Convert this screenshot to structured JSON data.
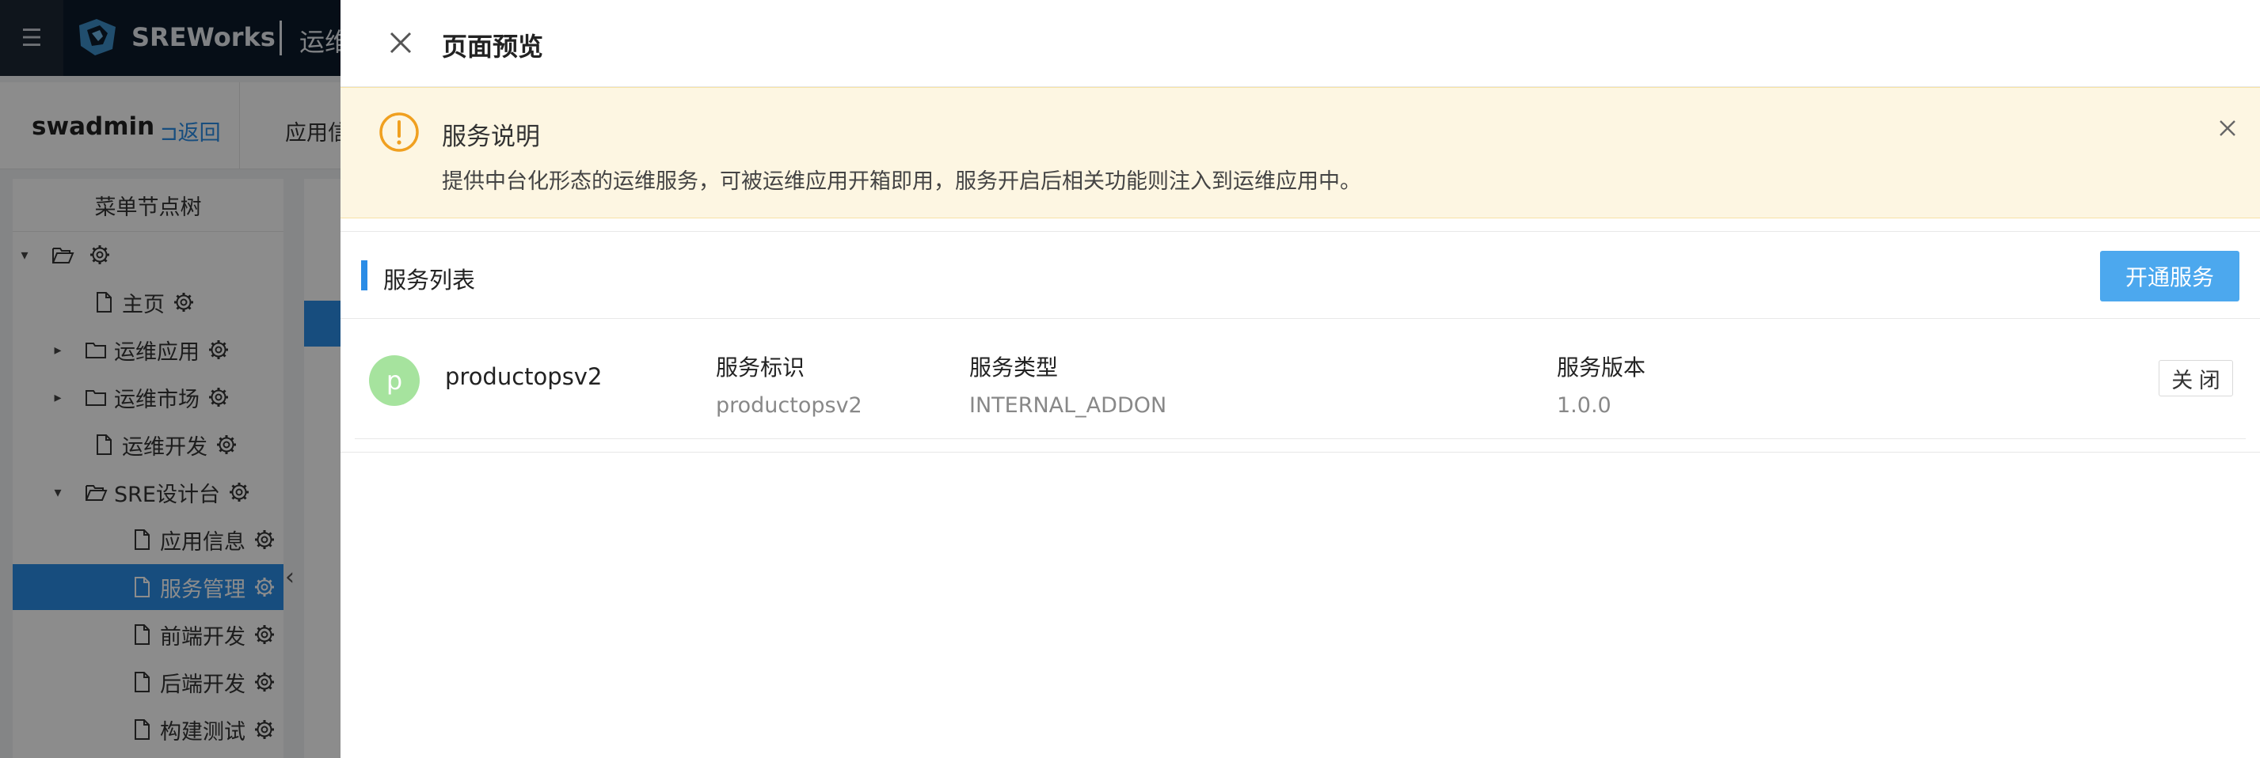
{
  "topbar": {
    "menu_icon": "hamburger-icon",
    "brand": "SREWorks",
    "subtitle": "运维"
  },
  "subbar": {
    "user": "swadmin",
    "back_label": "返回",
    "tab_label": "应用信"
  },
  "tree": {
    "title": "菜单节点树",
    "items": [
      {
        "label": "",
        "type": "folder-open",
        "expanded": true
      },
      {
        "label": "主页",
        "type": "file"
      },
      {
        "label": "运维应用",
        "type": "folder",
        "expanded": false
      },
      {
        "label": "运维市场",
        "type": "folder",
        "expanded": false
      },
      {
        "label": "运维开发",
        "type": "file"
      },
      {
        "label": "SRE设计台",
        "type": "folder-open",
        "expanded": true
      },
      {
        "label": "应用信息",
        "type": "file"
      },
      {
        "label": "服务管理",
        "type": "file",
        "selected": true
      },
      {
        "label": "前端开发",
        "type": "file"
      },
      {
        "label": "后端开发",
        "type": "file"
      },
      {
        "label": "构建测试",
        "type": "file"
      }
    ]
  },
  "drawer": {
    "title": "页面预览",
    "alert": {
      "title": "服务说明",
      "description": "提供中台化形态的运维服务，可被运维应用开箱即用，服务开启后相关功能则注入到运维应用中。"
    },
    "service_list": {
      "title": "服务列表",
      "open_button": "开通服务",
      "services": [
        {
          "avatar_letter": "p",
          "name": "productopsv2",
          "id_label": "服务标识",
          "id_value": "productopsv2",
          "type_label": "服务类型",
          "type_value": "INTERNAL_ADDON",
          "version_label": "服务版本",
          "version_value": "1.0.0",
          "action_label": "关 闭"
        }
      ]
    }
  },
  "colors": {
    "topbar": "#0c1a2a",
    "accent": "#2a8ce6",
    "primary_button": "#4ca8ee",
    "alert_bg": "#fdf6e2",
    "alert_icon": "#f0a020",
    "avatar": "#a6e39e"
  }
}
